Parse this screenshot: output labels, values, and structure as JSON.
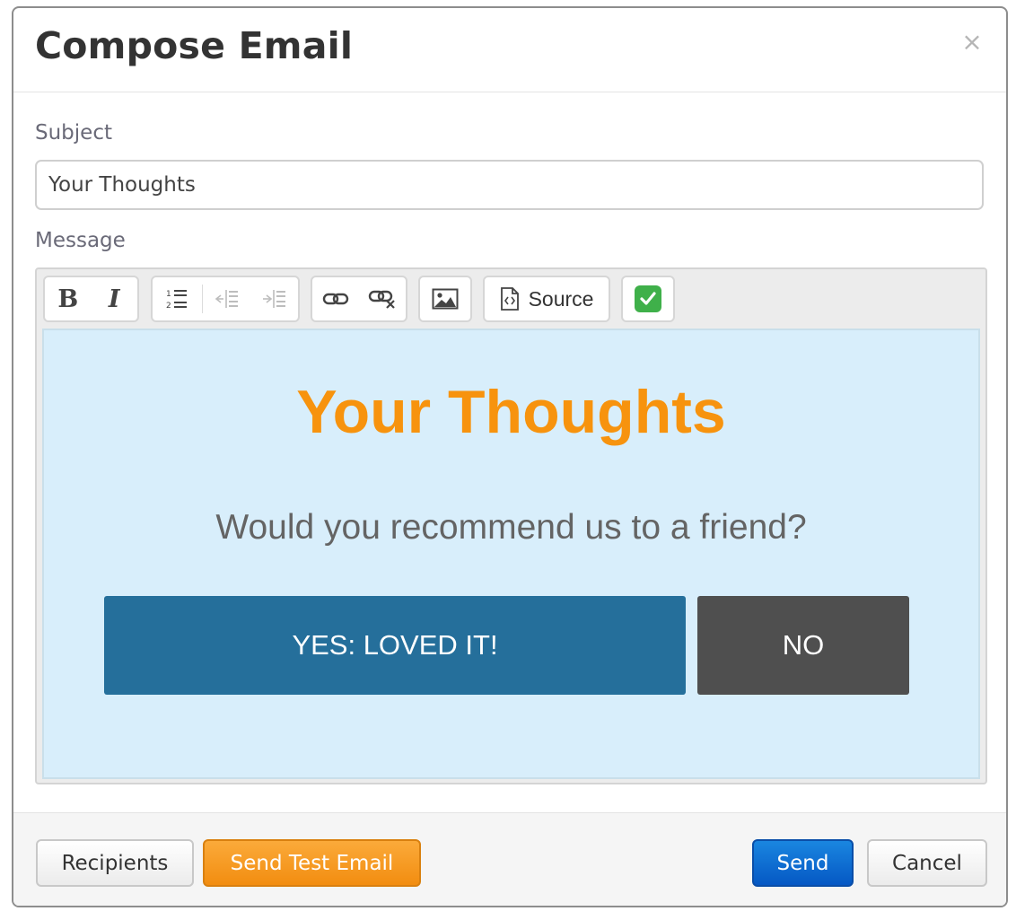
{
  "dialog": {
    "title": "Compose Email",
    "close_glyph": "×"
  },
  "form": {
    "subject_label": "Subject",
    "subject_value": "Your Thoughts",
    "message_label": "Message"
  },
  "toolbar": {
    "bold": "B",
    "italic": "I",
    "source_label": "Source",
    "icons": [
      "bold-icon",
      "italic-icon",
      "numbered-list-icon",
      "outdent-icon",
      "indent-icon",
      "link-icon",
      "unlink-icon",
      "image-icon",
      "source-icon",
      "checkmark-icon"
    ]
  },
  "content": {
    "title": "Your Thoughts",
    "question": "Would you recommend us to a friend?",
    "yes_button": "YES: LOVED IT!",
    "no_button": "NO"
  },
  "footer": {
    "recipients": "Recipients",
    "send_test": "Send Test Email",
    "send": "Send",
    "cancel": "Cancel"
  },
  "colors": {
    "accent_orange": "#f7930e",
    "content_bg": "#d8eefb",
    "yes_button": "#256f9b",
    "no_button": "#4f4f4f",
    "send_button": "#0a6ad6"
  }
}
